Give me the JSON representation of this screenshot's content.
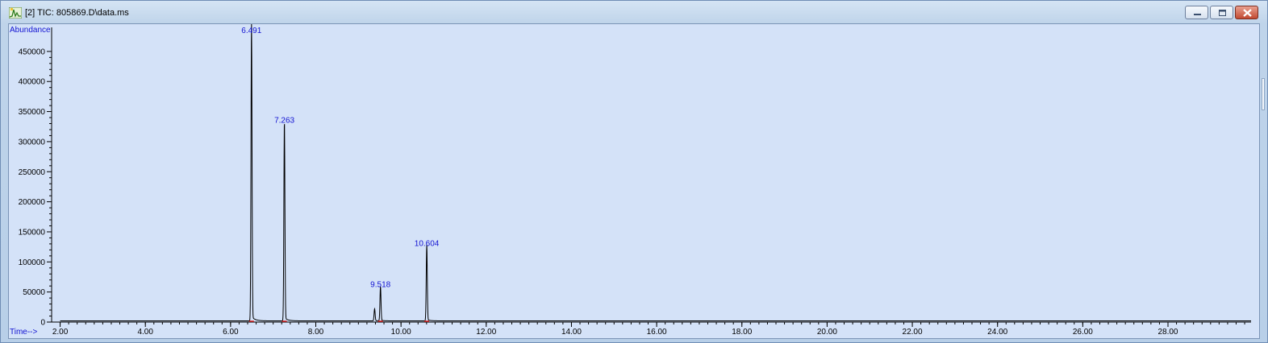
{
  "window": {
    "title": "[2] TIC: 805869.D\\data.ms",
    "icon": "chromatogram-icon",
    "controls": [
      "minimize-icon",
      "maximize-icon",
      "close-icon"
    ]
  },
  "chart_data": {
    "type": "line",
    "ylabel": "Abundance",
    "xlabel": "Time-->",
    "xlim": [
      1.8,
      29.95
    ],
    "ylim": [
      0,
      490000
    ],
    "x_ticks": [
      "2.00",
      "4.00",
      "6.00",
      "8.00",
      "10.00",
      "12.00",
      "14.00",
      "16.00",
      "18.00",
      "20.00",
      "22.00",
      "24.00",
      "26.00",
      "28.00"
    ],
    "y_ticks": [
      "0",
      "50000",
      "100000",
      "150000",
      "200000",
      "250000",
      "300000",
      "350000",
      "400000",
      "450000"
    ],
    "line_color": "#000000",
    "label_color": "#1414d2",
    "peaks": [
      {
        "rt": 6.491,
        "label": "6.491",
        "abundance": 490000
      },
      {
        "rt": 7.263,
        "label": "7.263",
        "abundance": 330000
      },
      {
        "rt": 9.518,
        "label": "9.518",
        "abundance": 57000
      },
      {
        "rt": 10.604,
        "label": "10.604",
        "abundance": 125000
      }
    ],
    "minor_peaks": [
      {
        "rt": 9.38,
        "abundance": 20000
      }
    ],
    "baseline": 2000
  }
}
